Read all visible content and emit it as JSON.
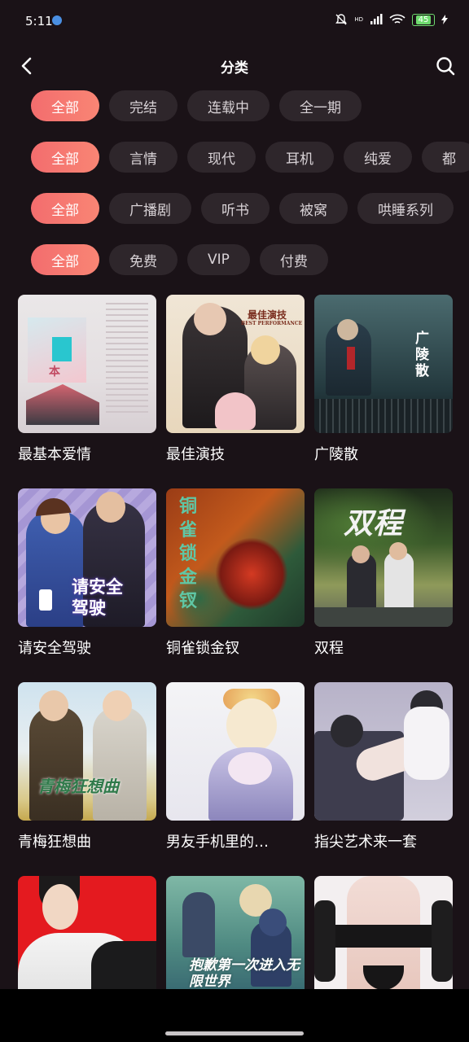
{
  "status": {
    "time": "5:11",
    "battery": "45",
    "hd_label": "HD"
  },
  "header": {
    "title": "分类"
  },
  "filters": {
    "row1": [
      "全部",
      "完结",
      "连载中",
      "全一期"
    ],
    "row2": [
      "全部",
      "言情",
      "现代",
      "耳机",
      "纯爱",
      "都"
    ],
    "row3": [
      "全部",
      "广播剧",
      "听书",
      "被窝",
      "哄睡系列"
    ],
    "row4": [
      "全部",
      "免费",
      "VIP",
      "付费"
    ]
  },
  "items": [
    {
      "title": "最基本爱情",
      "cover_text": "本"
    },
    {
      "title": "最佳演技",
      "cover_text": "最佳演技",
      "cover_sub": "BEST PERFORMANCE"
    },
    {
      "title": "广陵散",
      "cover_text": "广陵散"
    },
    {
      "title": "请安全驾驶",
      "cover_text": "请安全驾驶"
    },
    {
      "title": "铜雀锁金钗",
      "cover_text": "铜雀锁金钗"
    },
    {
      "title": "双程",
      "cover_text": "双程"
    },
    {
      "title": "青梅狂想曲",
      "cover_text": "青梅狂想曲"
    },
    {
      "title": "男友手机里的…",
      "cover_text": ""
    },
    {
      "title": "指尖艺术来一套",
      "cover_text": ""
    },
    {
      "title": "",
      "cover_text": ""
    },
    {
      "title": "",
      "cover_text": "抱歉第一次进入无限世界"
    },
    {
      "title": "",
      "cover_text": ""
    }
  ],
  "colors": {
    "bg": "#1a1217",
    "chip_active": "#f36d6e",
    "chip": "#2e262b"
  }
}
